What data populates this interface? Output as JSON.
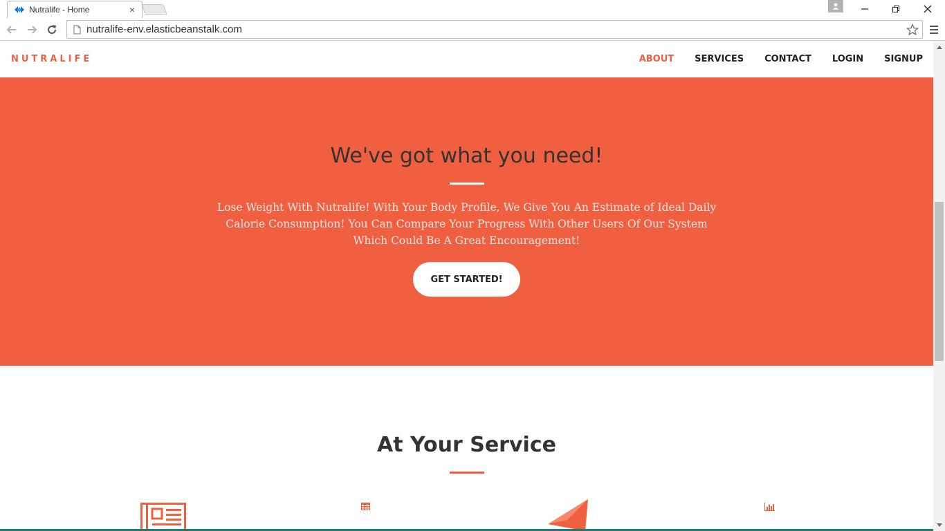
{
  "browser": {
    "tab_title": "Nutralife - Home",
    "tab_close": "×",
    "url": "nutralife-env.elasticbeanstalk.com"
  },
  "site": {
    "brand": "NUTRALIFE",
    "nav": [
      {
        "label": "ABOUT",
        "active": true
      },
      {
        "label": "SERVICES",
        "active": false
      },
      {
        "label": "CONTACT",
        "active": false
      },
      {
        "label": "LOGIN",
        "active": false
      },
      {
        "label": "SIGNUP",
        "active": false
      }
    ]
  },
  "hero": {
    "title": "We've got what you need!",
    "text": "Lose Weight With Nutralife! With Your Body Profile, We Give You An Estimate of Ideal Daily Calorie Consumption! You Can Compare Your Progress With Other Users Of Our System Which Could Be A Great Encouragement!",
    "button": "GET STARTED!"
  },
  "services": {
    "title": "At Your Service",
    "icons": [
      "newspaper-icon",
      "table-icon",
      "paper-plane-icon",
      "bar-chart-icon"
    ]
  },
  "colors": {
    "accent": "#f05f40",
    "text_dark": "#333333",
    "white": "#ffffff"
  }
}
